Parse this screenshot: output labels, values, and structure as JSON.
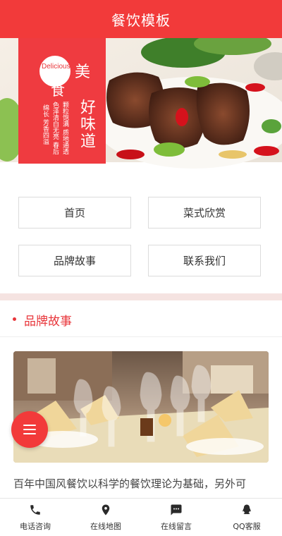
{
  "header": {
    "title": "餐饮模板"
  },
  "banner": {
    "logo_script": "Delicious",
    "mei": "美",
    "shi": "食",
    "headline": "好味道",
    "line1": "颗粒饱满 质地通透",
    "line2": "色泽清白无亮 春后",
    "line3": "绵长 芳香四溢"
  },
  "nav": {
    "items": [
      {
        "label": "首页"
      },
      {
        "label": "菜式欣赏"
      },
      {
        "label": "品牌故事"
      },
      {
        "label": "联系我们"
      }
    ]
  },
  "section": {
    "title": "品牌故事"
  },
  "story": {
    "text": "百年中国风餐饮以科学的餐饮理论为基础，另外可"
  },
  "bottom_bar": {
    "tabs": [
      {
        "label": "电话咨询",
        "icon": "phone-icon"
      },
      {
        "label": "在线地图",
        "icon": "map-pin-icon"
      },
      {
        "label": "在线留言",
        "icon": "chat-icon"
      },
      {
        "label": "QQ客服",
        "icon": "qq-icon"
      }
    ]
  },
  "colors": {
    "accent": "#f23a3a",
    "divider": "#f5e3e1"
  }
}
